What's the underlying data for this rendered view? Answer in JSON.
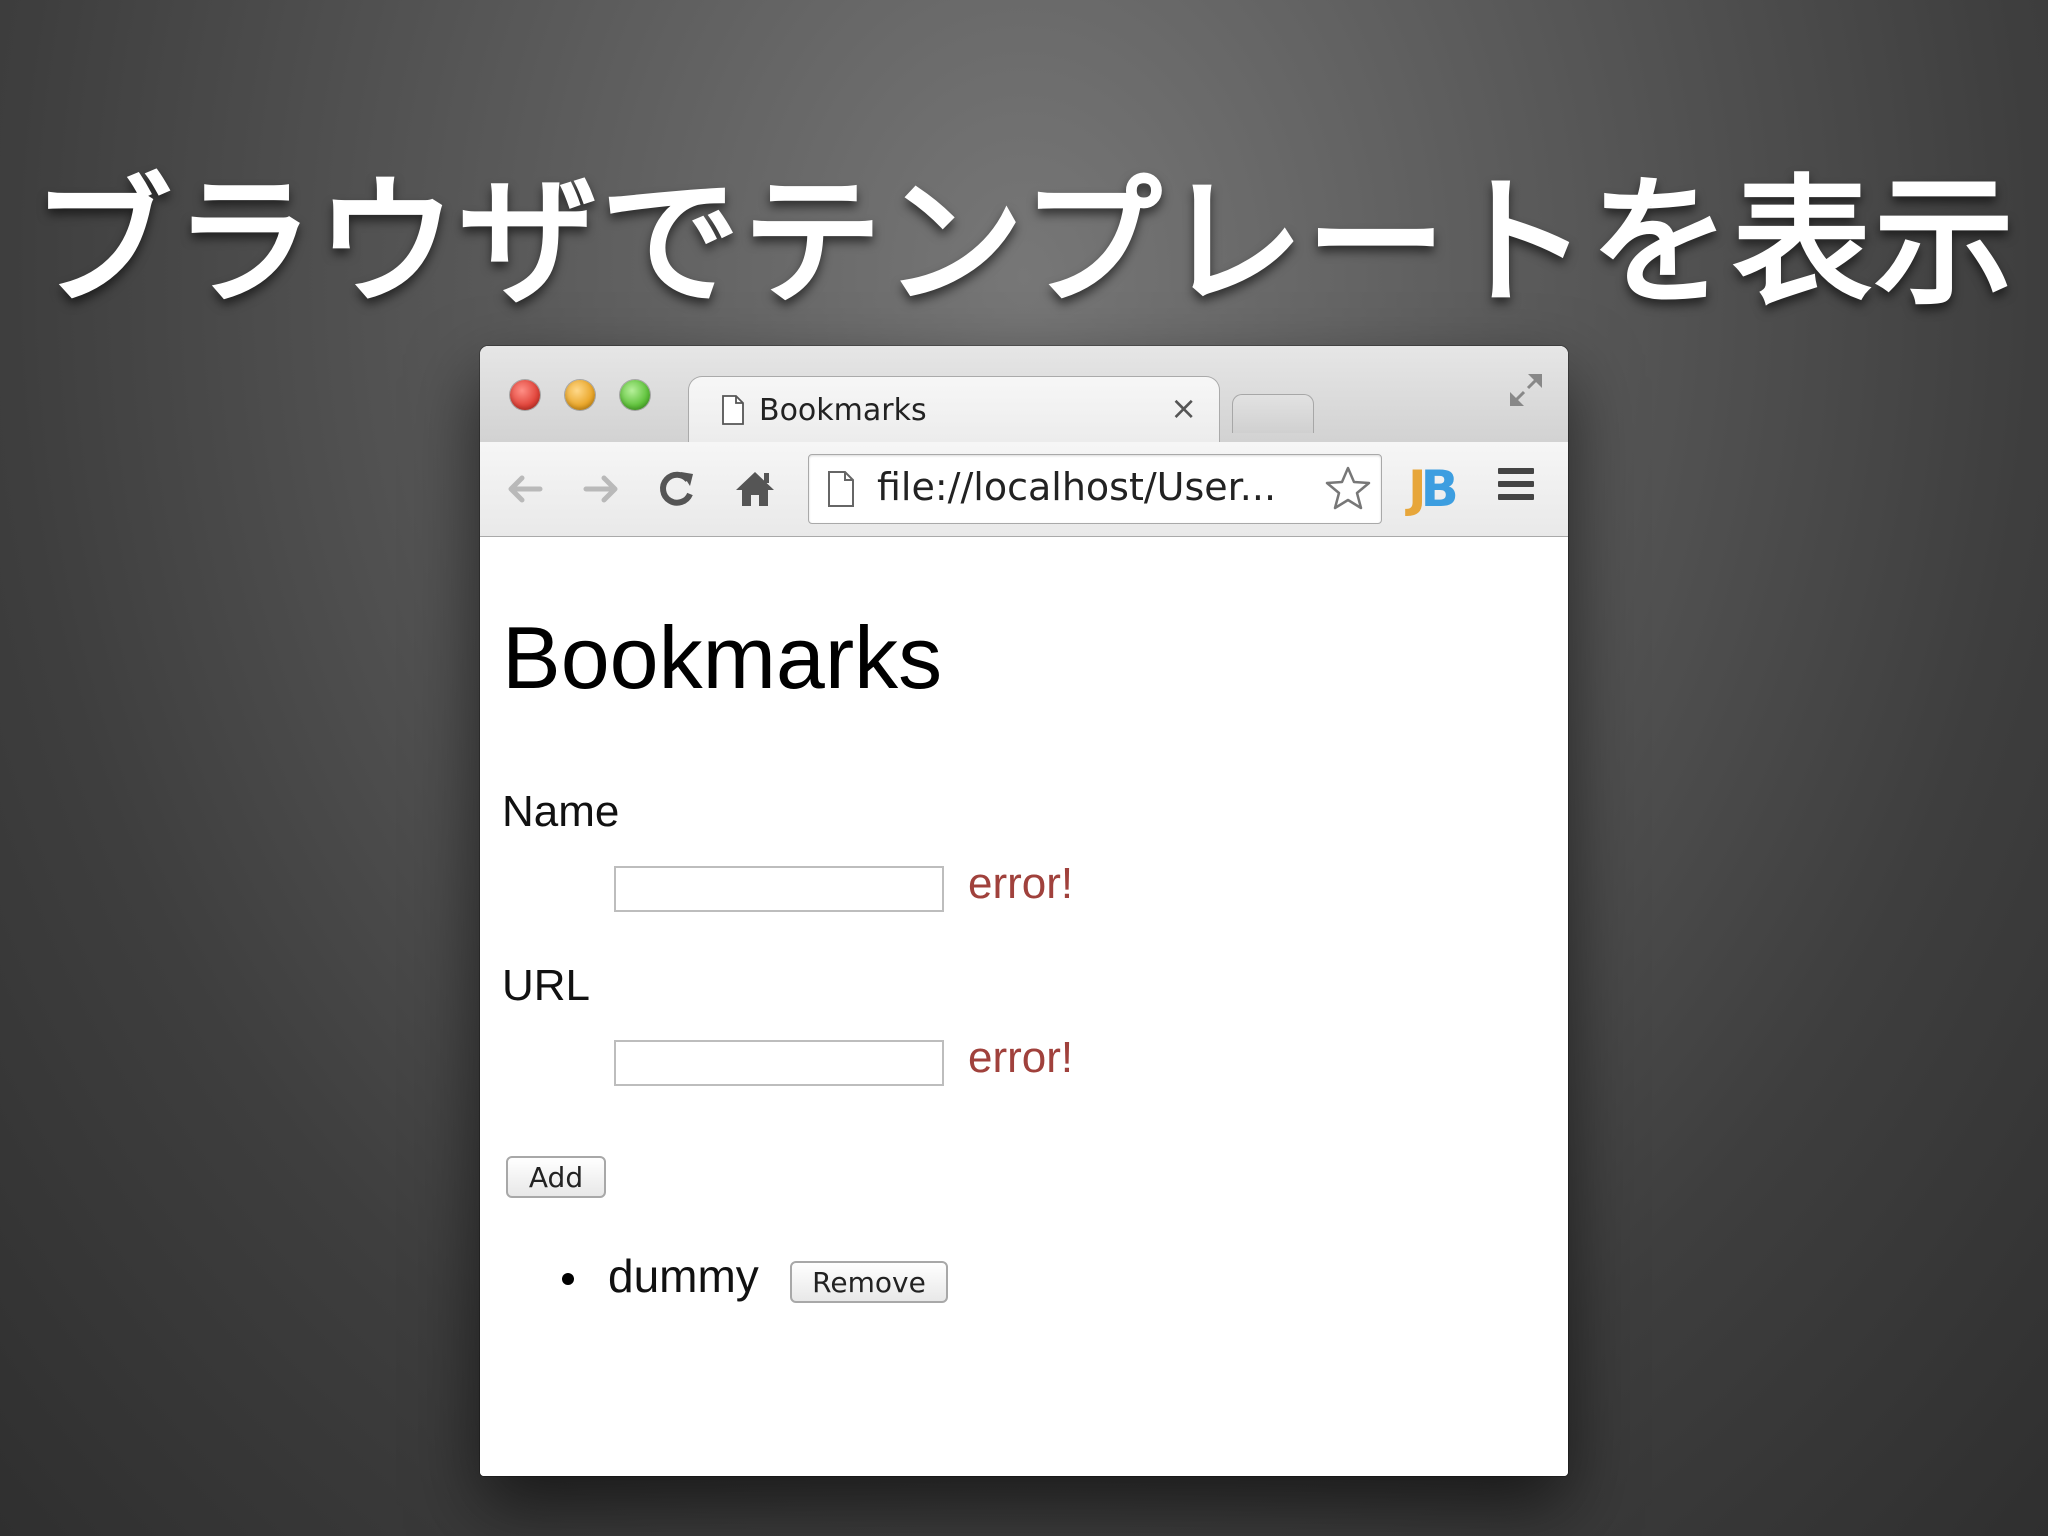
{
  "slide": {
    "title": "ブラウザでテンプレートを表示"
  },
  "browser": {
    "tab_title": "Bookmarks",
    "tab_close": "×",
    "url": "file://localhost/User...",
    "extension_label_j": "J",
    "extension_label_b": "B"
  },
  "page": {
    "heading": "Bookmarks",
    "form": {
      "name_label": "Name",
      "name_value": "",
      "name_error": "error!",
      "url_label": "URL",
      "url_value": "",
      "url_error": "error!",
      "add_button": "Add"
    },
    "bookmarks": [
      {
        "name": "dummy",
        "remove_button": "Remove"
      }
    ]
  },
  "colors": {
    "error": "#a0413c",
    "close": "#e0443a",
    "minimize": "#e9a62a",
    "maximize": "#5fc23b",
    "jb_j": "#e7a63a",
    "jb_b": "#3d9ee0"
  }
}
